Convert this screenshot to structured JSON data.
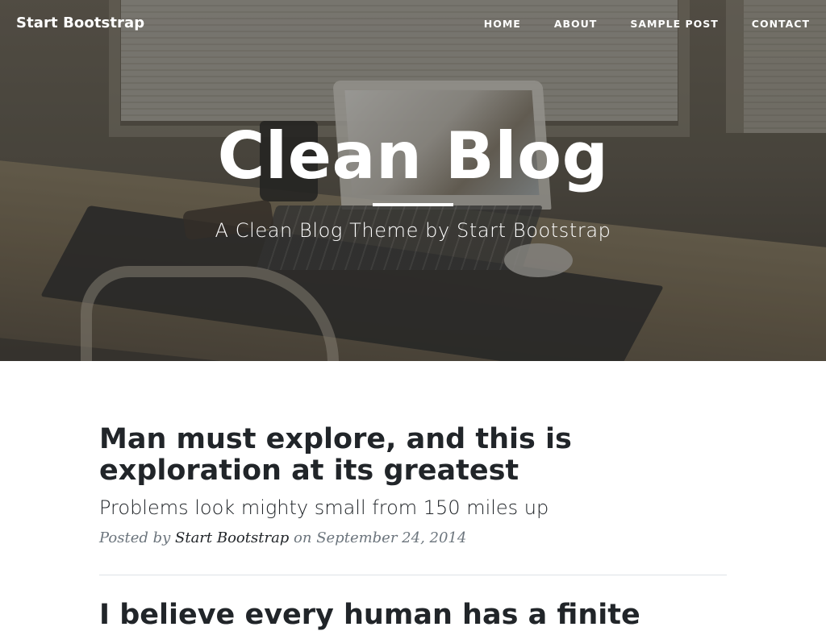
{
  "navbar": {
    "brand": "Start Bootstrap",
    "links": [
      "HOME",
      "ABOUT",
      "SAMPLE POST",
      "CONTACT"
    ]
  },
  "header": {
    "title": "Clean Blog",
    "subtitle": "A Clean Blog Theme by Start Bootstrap"
  },
  "posts": [
    {
      "title": "Man must explore, and this is exploration at its greatest",
      "subtitle": "Problems look mighty small from 150 miles up",
      "meta_prefix": "Posted by ",
      "author": "Start Bootstrap",
      "meta_middle": " on ",
      "date": "September 24, 2014"
    },
    {
      "title": "I believe every human has a finite"
    }
  ],
  "colors": {
    "text_dark": "#212529",
    "meta_gray": "#6c757d",
    "divider": "#dee2e6"
  }
}
